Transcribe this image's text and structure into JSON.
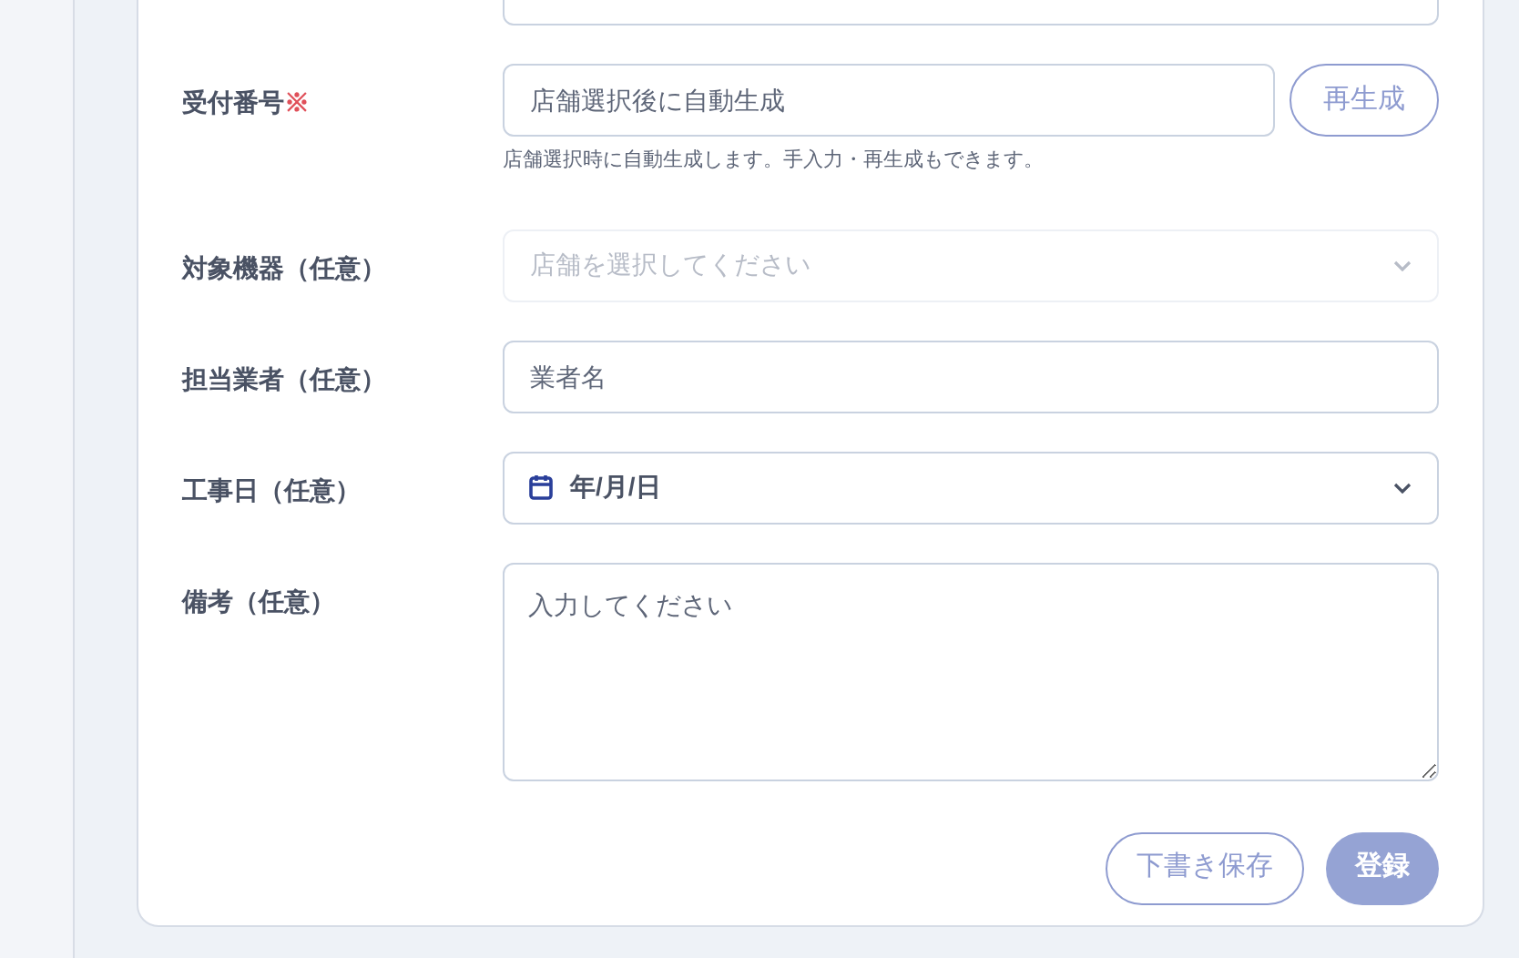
{
  "form": {
    "fields": [
      {
        "kind": "top_partial"
      },
      {
        "kind": "text_button",
        "label": "受付番号",
        "required_mark": "※",
        "placeholder": "店舗選択後に自動生成",
        "button": "再生成",
        "hint": "店舗選択時に自動生成します。手入力・再生成もできます。"
      },
      {
        "kind": "select",
        "label": "対象機器（任意）",
        "placeholder": "店舗を選択してください",
        "disabled": true
      },
      {
        "kind": "text",
        "label": "担当業者（任意）",
        "placeholder": "業者名"
      },
      {
        "kind": "date",
        "label": "工事日（任意）",
        "value": "年/月/日"
      },
      {
        "kind": "textarea",
        "label": "備考（任意）",
        "placeholder": "入力してください"
      }
    ],
    "buttons": [
      {
        "label": "下書き保存",
        "kind": "outline"
      },
      {
        "label": "登録",
        "kind": "primary",
        "disabled": true
      }
    ]
  }
}
